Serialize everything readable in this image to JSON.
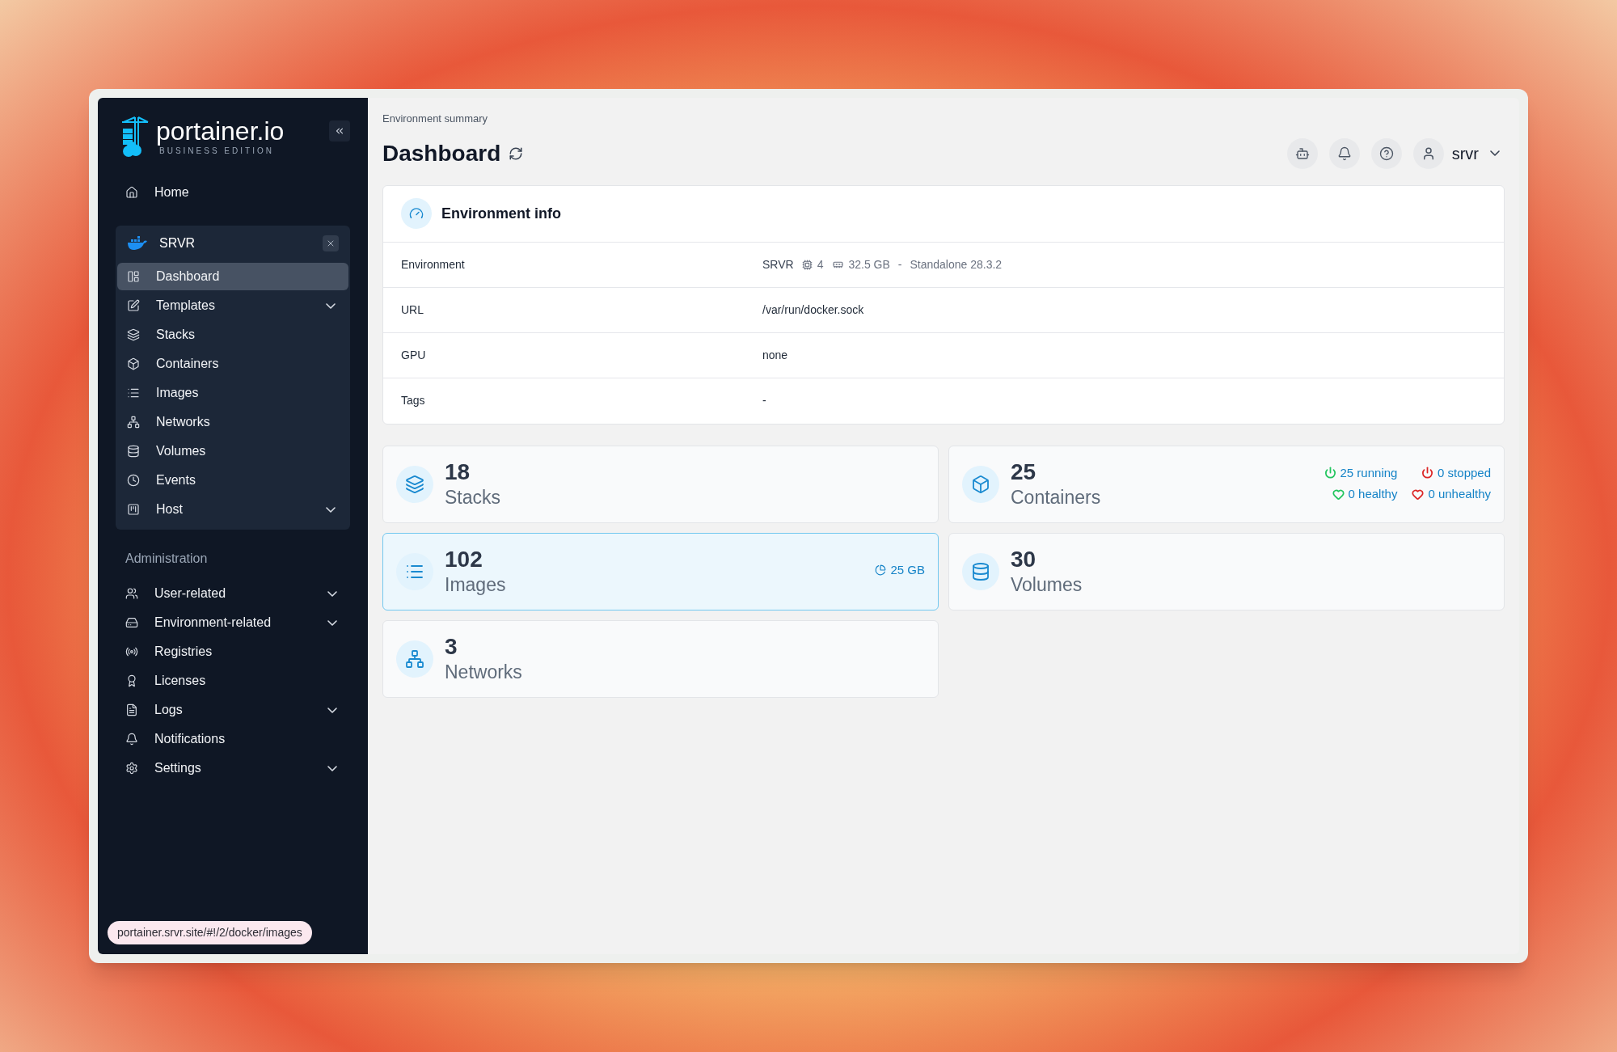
{
  "sidebar": {
    "logo": {
      "name": "portainer.io",
      "edition": "BUSINESS EDITION"
    },
    "home": {
      "label": "Home",
      "kind": "home"
    },
    "environment": {
      "name": "SRVR",
      "items": [
        {
          "label": "Dashboard",
          "kind": "dashboard",
          "selected": true,
          "expandable": false
        },
        {
          "label": "Templates",
          "kind": "templates",
          "selected": false,
          "expandable": true
        },
        {
          "label": "Stacks",
          "kind": "stacks",
          "selected": false,
          "expandable": false
        },
        {
          "label": "Containers",
          "kind": "containers",
          "selected": false,
          "expandable": false
        },
        {
          "label": "Images",
          "kind": "images",
          "selected": false,
          "expandable": false
        },
        {
          "label": "Networks",
          "kind": "networks",
          "selected": false,
          "expandable": false
        },
        {
          "label": "Volumes",
          "kind": "volumes",
          "selected": false,
          "expandable": false
        },
        {
          "label": "Events",
          "kind": "events",
          "selected": false,
          "expandable": false
        },
        {
          "label": "Host",
          "kind": "host",
          "selected": false,
          "expandable": true
        }
      ]
    },
    "admin": {
      "heading": "Administration",
      "items": [
        {
          "label": "User-related",
          "kind": "users",
          "selected": false,
          "expandable": true
        },
        {
          "label": "Environment-related",
          "kind": "environments",
          "selected": false,
          "expandable": true
        },
        {
          "label": "Registries",
          "kind": "registries",
          "selected": false,
          "expandable": false
        },
        {
          "label": "Licenses",
          "kind": "licenses",
          "selected": false,
          "expandable": false
        },
        {
          "label": "Logs",
          "kind": "logs",
          "selected": false,
          "expandable": true
        },
        {
          "label": "Notifications",
          "kind": "notifications",
          "selected": false,
          "expandable": false
        },
        {
          "label": "Settings",
          "kind": "settings",
          "selected": false,
          "expandable": true
        }
      ]
    }
  },
  "status_link": "portainer.srvr.site/#!/2/docker/images",
  "header": {
    "breadcrumb": "Environment summary",
    "title": "Dashboard",
    "user": "srvr"
  },
  "environment_info": {
    "title": "Environment info",
    "rows": [
      {
        "label": "Environment",
        "kind": "environment",
        "name": "SRVR",
        "cpu": "4",
        "memory": "32.5 GB",
        "separator": "-",
        "version": "Standalone 28.3.2"
      },
      {
        "label": "URL",
        "kind": "text",
        "value": "/var/run/docker.sock"
      },
      {
        "label": "GPU",
        "kind": "text",
        "value": "none"
      },
      {
        "label": "Tags",
        "kind": "text",
        "value": "-"
      }
    ]
  },
  "stats": [
    {
      "kind": "stacks",
      "count": "18",
      "label": "Stacks",
      "selected": false
    },
    {
      "kind": "containers",
      "count": "25",
      "label": "Containers",
      "selected": false,
      "statuses": [
        {
          "kind": "power",
          "text": "25 running",
          "color": "#22c55e"
        },
        {
          "kind": "power",
          "text": "0 stopped",
          "color": "#dc2626"
        },
        {
          "kind": "heart",
          "text": "0 healthy",
          "color": "#22c55e"
        },
        {
          "kind": "heart",
          "text": "0 unhealthy",
          "color": "#dc2626"
        }
      ]
    },
    {
      "kind": "images",
      "count": "102",
      "label": "Images",
      "selected": true,
      "size": "25 GB"
    },
    {
      "kind": "volumes",
      "count": "30",
      "label": "Volumes",
      "selected": false
    },
    {
      "kind": "networks",
      "count": "3",
      "label": "Networks",
      "selected": false
    }
  ]
}
